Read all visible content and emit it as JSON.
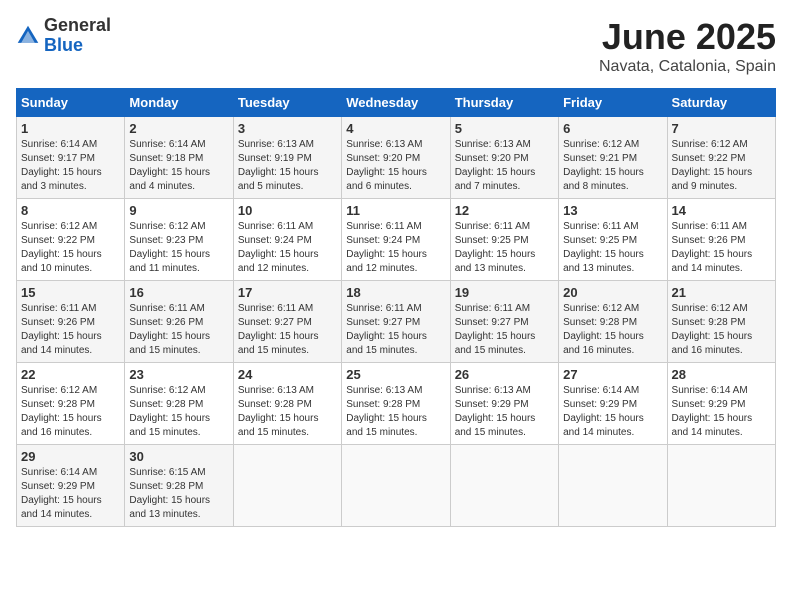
{
  "logo": {
    "general": "General",
    "blue": "Blue"
  },
  "title": "June 2025",
  "subtitle": "Navata, Catalonia, Spain",
  "days_of_week": [
    "Sunday",
    "Monday",
    "Tuesday",
    "Wednesday",
    "Thursday",
    "Friday",
    "Saturday"
  ],
  "weeks": [
    [
      {
        "day": 1,
        "sunrise": "6:14 AM",
        "sunset": "9:17 PM",
        "daylight": "15 hours and 3 minutes."
      },
      {
        "day": 2,
        "sunrise": "6:14 AM",
        "sunset": "9:18 PM",
        "daylight": "15 hours and 4 minutes."
      },
      {
        "day": 3,
        "sunrise": "6:13 AM",
        "sunset": "9:19 PM",
        "daylight": "15 hours and 5 minutes."
      },
      {
        "day": 4,
        "sunrise": "6:13 AM",
        "sunset": "9:20 PM",
        "daylight": "15 hours and 6 minutes."
      },
      {
        "day": 5,
        "sunrise": "6:13 AM",
        "sunset": "9:20 PM",
        "daylight": "15 hours and 7 minutes."
      },
      {
        "day": 6,
        "sunrise": "6:12 AM",
        "sunset": "9:21 PM",
        "daylight": "15 hours and 8 minutes."
      },
      {
        "day": 7,
        "sunrise": "6:12 AM",
        "sunset": "9:22 PM",
        "daylight": "15 hours and 9 minutes."
      }
    ],
    [
      {
        "day": 8,
        "sunrise": "6:12 AM",
        "sunset": "9:22 PM",
        "daylight": "15 hours and 10 minutes."
      },
      {
        "day": 9,
        "sunrise": "6:12 AM",
        "sunset": "9:23 PM",
        "daylight": "15 hours and 11 minutes."
      },
      {
        "day": 10,
        "sunrise": "6:11 AM",
        "sunset": "9:24 PM",
        "daylight": "15 hours and 12 minutes."
      },
      {
        "day": 11,
        "sunrise": "6:11 AM",
        "sunset": "9:24 PM",
        "daylight": "15 hours and 12 minutes."
      },
      {
        "day": 12,
        "sunrise": "6:11 AM",
        "sunset": "9:25 PM",
        "daylight": "15 hours and 13 minutes."
      },
      {
        "day": 13,
        "sunrise": "6:11 AM",
        "sunset": "9:25 PM",
        "daylight": "15 hours and 13 minutes."
      },
      {
        "day": 14,
        "sunrise": "6:11 AM",
        "sunset": "9:26 PM",
        "daylight": "15 hours and 14 minutes."
      }
    ],
    [
      {
        "day": 15,
        "sunrise": "6:11 AM",
        "sunset": "9:26 PM",
        "daylight": "15 hours and 14 minutes."
      },
      {
        "day": 16,
        "sunrise": "6:11 AM",
        "sunset": "9:26 PM",
        "daylight": "15 hours and 15 minutes."
      },
      {
        "day": 17,
        "sunrise": "6:11 AM",
        "sunset": "9:27 PM",
        "daylight": "15 hours and 15 minutes."
      },
      {
        "day": 18,
        "sunrise": "6:11 AM",
        "sunset": "9:27 PM",
        "daylight": "15 hours and 15 minutes."
      },
      {
        "day": 19,
        "sunrise": "6:11 AM",
        "sunset": "9:27 PM",
        "daylight": "15 hours and 15 minutes."
      },
      {
        "day": 20,
        "sunrise": "6:12 AM",
        "sunset": "9:28 PM",
        "daylight": "15 hours and 16 minutes."
      },
      {
        "day": 21,
        "sunrise": "6:12 AM",
        "sunset": "9:28 PM",
        "daylight": "15 hours and 16 minutes."
      }
    ],
    [
      {
        "day": 22,
        "sunrise": "6:12 AM",
        "sunset": "9:28 PM",
        "daylight": "15 hours and 16 minutes."
      },
      {
        "day": 23,
        "sunrise": "6:12 AM",
        "sunset": "9:28 PM",
        "daylight": "15 hours and 15 minutes."
      },
      {
        "day": 24,
        "sunrise": "6:13 AM",
        "sunset": "9:28 PM",
        "daylight": "15 hours and 15 minutes."
      },
      {
        "day": 25,
        "sunrise": "6:13 AM",
        "sunset": "9:28 PM",
        "daylight": "15 hours and 15 minutes."
      },
      {
        "day": 26,
        "sunrise": "6:13 AM",
        "sunset": "9:29 PM",
        "daylight": "15 hours and 15 minutes."
      },
      {
        "day": 27,
        "sunrise": "6:14 AM",
        "sunset": "9:29 PM",
        "daylight": "15 hours and 14 minutes."
      },
      {
        "day": 28,
        "sunrise": "6:14 AM",
        "sunset": "9:29 PM",
        "daylight": "15 hours and 14 minutes."
      }
    ],
    [
      {
        "day": 29,
        "sunrise": "6:14 AM",
        "sunset": "9:29 PM",
        "daylight": "15 hours and 14 minutes."
      },
      {
        "day": 30,
        "sunrise": "6:15 AM",
        "sunset": "9:28 PM",
        "daylight": "15 hours and 13 minutes."
      },
      null,
      null,
      null,
      null,
      null
    ]
  ]
}
